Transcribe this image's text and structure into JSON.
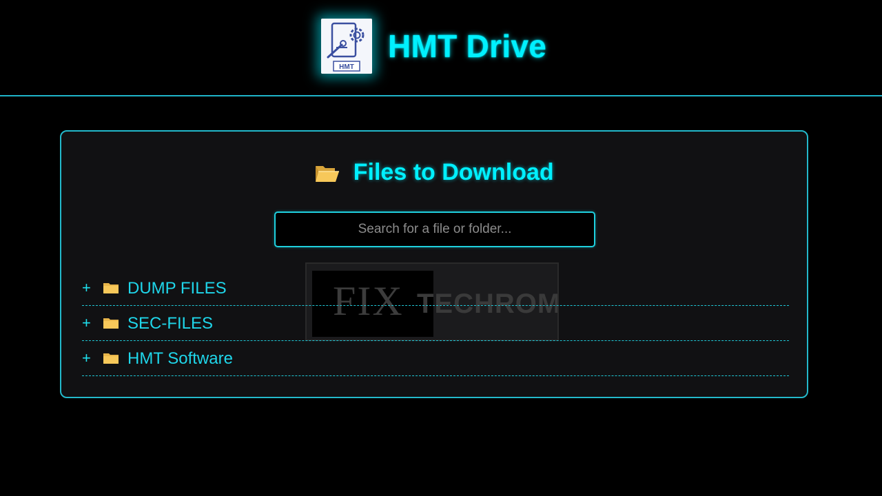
{
  "header": {
    "site_title": "HMT Drive",
    "logo_text": "HMT"
  },
  "panel": {
    "title": "Files to Download",
    "search": {
      "placeholder": "Search for a file or folder...",
      "value": ""
    },
    "folders": [
      {
        "label": "DUMP FILES",
        "toggle": "+"
      },
      {
        "label": "SEC-FILES",
        "toggle": "+"
      },
      {
        "label": "HMT Software",
        "toggle": "+"
      }
    ]
  },
  "watermark": {
    "part1": "FIX",
    "part2": "TECHROM"
  },
  "colors": {
    "accent": "#00f0ff",
    "border": "#23b9cb",
    "panel_bg": "#111113",
    "page_bg": "#000000",
    "folder": "#f7c85a"
  },
  "icons": {
    "logo": "gear-wrench-document-icon",
    "title": "open-folder-icon",
    "row": "folder-icon",
    "toggle": "plus-icon"
  }
}
